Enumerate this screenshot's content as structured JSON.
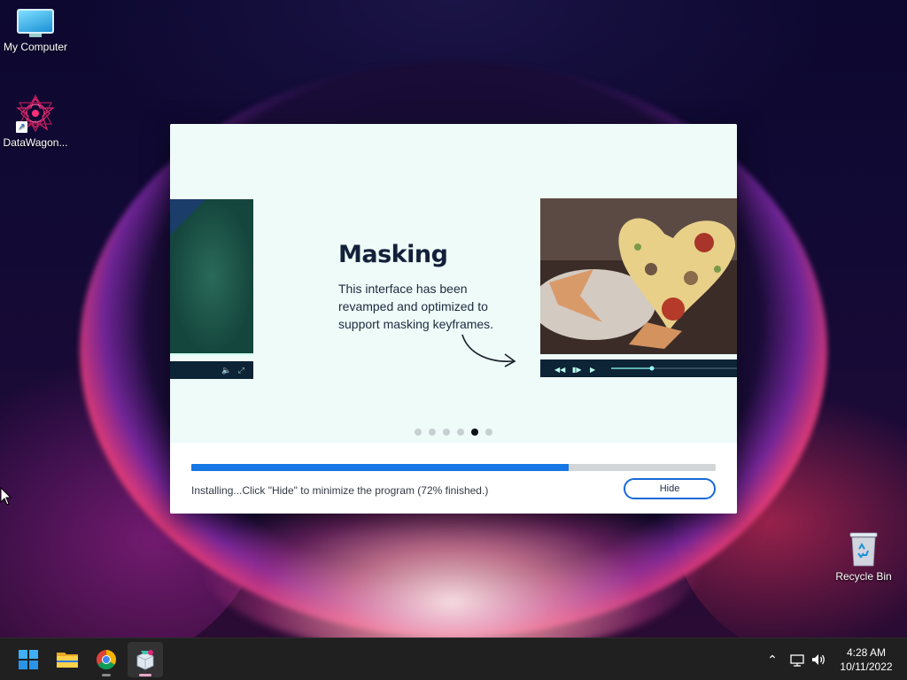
{
  "desktop": {
    "icons": [
      {
        "label": "My Computer",
        "icon": "monitor-icon"
      },
      {
        "label": "DataWagon...",
        "icon": "star-app-icon"
      },
      {
        "label": "Recycle Bin",
        "icon": "recycle-bin-icon"
      }
    ]
  },
  "installer": {
    "slide": {
      "title": "Masking",
      "text": "This interface has been revamped and optimized to support masking keyframes.",
      "total_slides": 6,
      "active_slide": 5
    },
    "progress_percent": 72,
    "status": "Installing...Click \"Hide\" to minimize the program (72% finished.)",
    "hide_label": "Hide",
    "colors": {
      "accent": "#1677e5",
      "title": "#13203b"
    }
  },
  "taskbar": {
    "apps": [
      "start-icon",
      "file-explorer-icon",
      "chrome-icon",
      "installer-icon"
    ],
    "tray": [
      "chevron-up-icon",
      "network-icon",
      "volume-icon"
    ],
    "time": "4:28 AM",
    "date": "10/11/2022"
  }
}
